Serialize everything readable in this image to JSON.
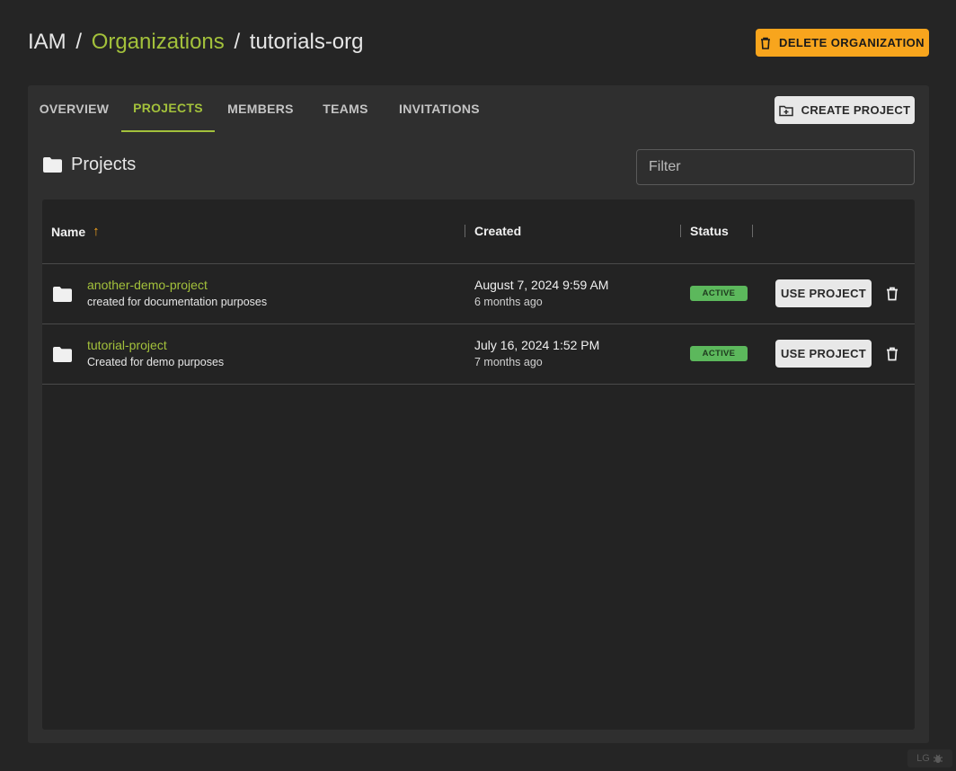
{
  "breadcrumb": {
    "root": "IAM",
    "separator": "/",
    "parent": "Organizations",
    "current": "tutorials-org"
  },
  "header": {
    "delete_org_label": "DELETE ORGANIZATION"
  },
  "tabs": [
    {
      "label": "OVERVIEW",
      "active": false
    },
    {
      "label": "PROJECTS",
      "active": true
    },
    {
      "label": "MEMBERS",
      "active": false
    },
    {
      "label": "TEAMS",
      "active": false
    },
    {
      "label": "INVITATIONS",
      "active": false
    }
  ],
  "toolbar": {
    "create_project_label": "CREATE PROJECT"
  },
  "section": {
    "title": "Projects",
    "filter_placeholder": "Filter"
  },
  "table": {
    "columns": {
      "name": "Name",
      "created": "Created",
      "status": "Status"
    },
    "rows": [
      {
        "name": "another-demo-project",
        "description": "created for documentation purposes",
        "created": "August 7, 2024 9:59 AM",
        "created_relative": "6 months ago",
        "status": "ACTIVE",
        "action": "USE PROJECT"
      },
      {
        "name": "tutorial-project",
        "description": "Created for demo purposes",
        "created": "July 16, 2024 1:52 PM",
        "created_relative": "7 months ago",
        "status": "ACTIVE",
        "action": "USE PROJECT"
      }
    ]
  },
  "footer_badge": "LG",
  "colors": {
    "accent": "#a3c13b",
    "warning": "#f8a51d",
    "success": "#5cb85c",
    "background": "#252525"
  }
}
